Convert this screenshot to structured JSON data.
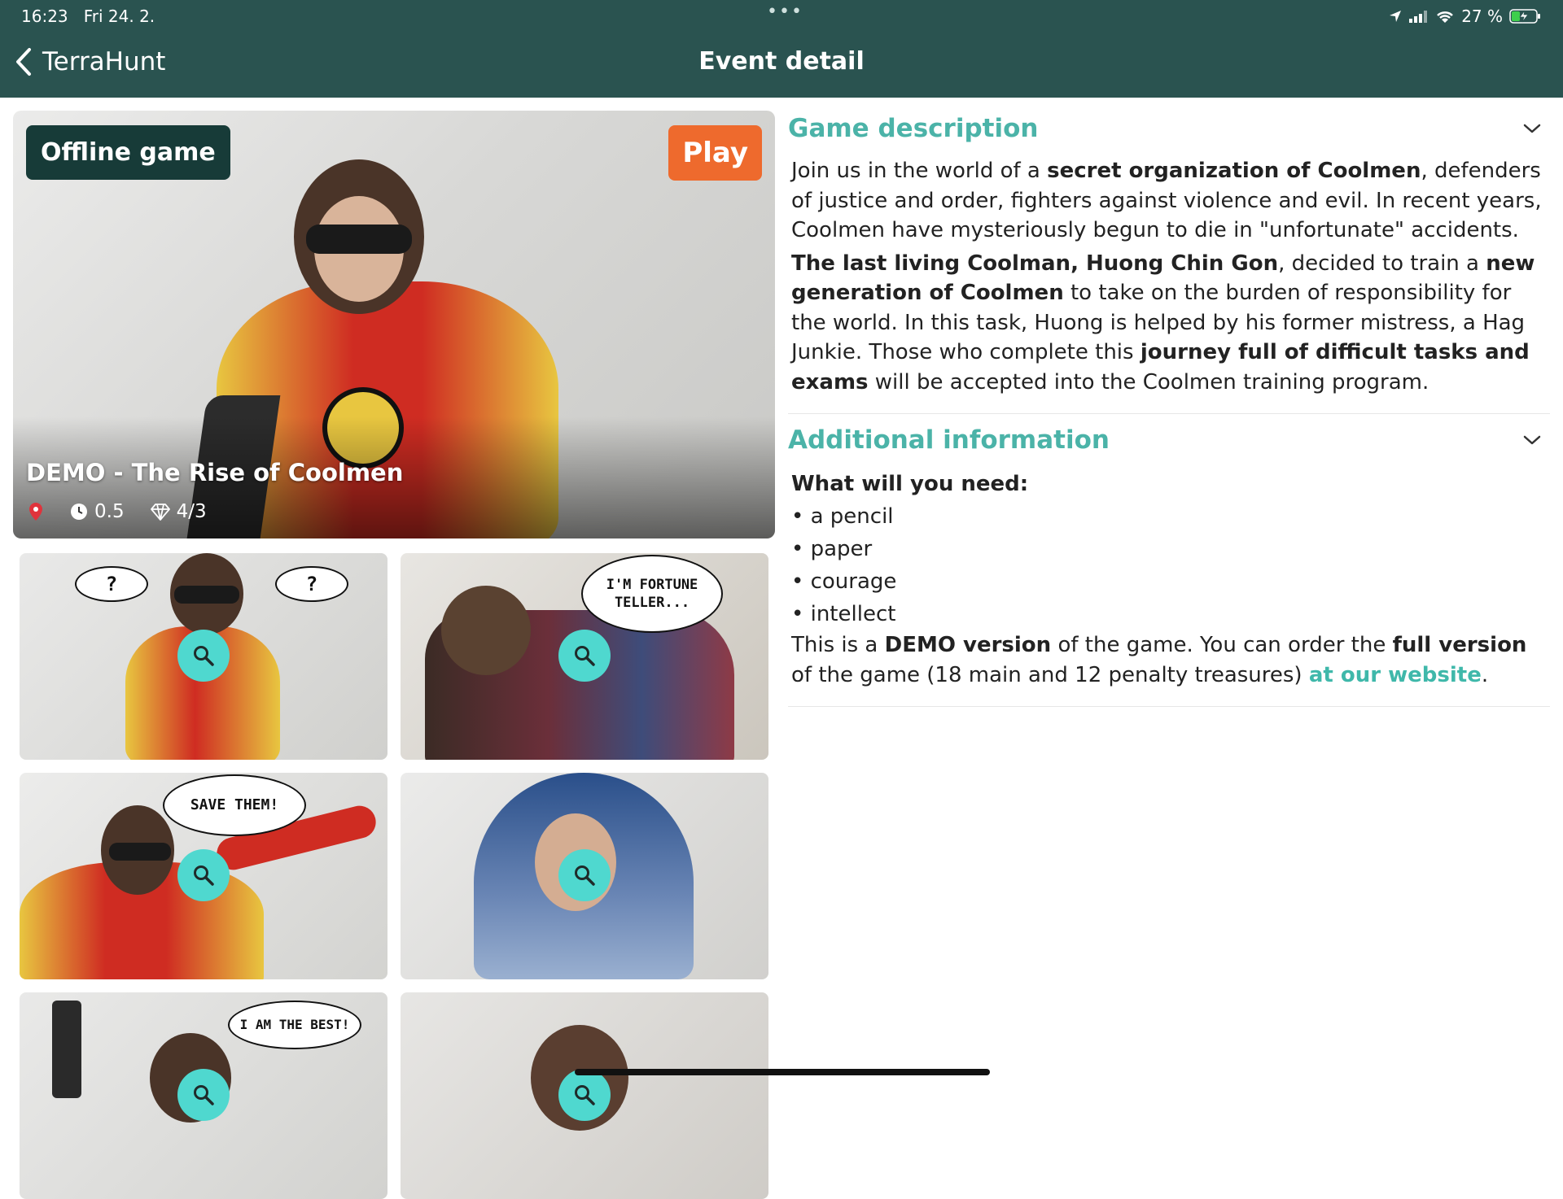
{
  "status_bar": {
    "time": "16:23",
    "date": "Fri 24. 2.",
    "battery": "27 %"
  },
  "nav": {
    "back_label": "TerraHunt",
    "title": "Event detail"
  },
  "hero": {
    "badge": "Offline game",
    "play_label": "Play",
    "title": "DEMO - The Rise of Coolmen",
    "duration": "0.5",
    "treasures": "4/3"
  },
  "thumbnails": [
    {
      "bubble_left": "?",
      "bubble_right": "?"
    },
    {
      "bubble": "I'M FORTUNE TELLER..."
    },
    {
      "bubble": "SAVE THEM!"
    },
    {},
    {
      "bubble": "I AM THE BEST!"
    },
    {}
  ],
  "description": {
    "title": "Game description",
    "p1": {
      "a": "Join us in the world of a ",
      "b": "secret organization of Coolmen",
      "c": ", defenders of justice and order, fighters against violence and evil. In recent years, Coolmen have mysteriously begun to die in \"unfortunate\" accidents."
    },
    "p2": {
      "a": "The last living Coolman, Huong Chin Gon",
      "b": ", decided to train a ",
      "c": "new generation of Coolmen",
      "d": " to take on the burden of responsibility for the world. In this task, Huong is helped by his former mistress, a Hag Junkie. Those who complete this ",
      "e": "journey full of difficult tasks and exams",
      "f": " will be accepted into the Coolmen training program."
    }
  },
  "additional": {
    "title": "Additional information",
    "need_heading": "What will you need:",
    "items": [
      "a pencil",
      "paper",
      "courage",
      "intellect"
    ],
    "demo": {
      "a": "This is a ",
      "b": "DEMO version",
      "c": " of the game. You can order the ",
      "d": "full version",
      "e": " of the game (18 main and 12 penalty treasures) ",
      "link": "at our website",
      "f": "."
    }
  },
  "colors": {
    "header": "#2a5350",
    "accent": "#4bb3a8",
    "play": "#ee6a2d",
    "badge": "#173b38",
    "zoom": "#4fd8cf"
  }
}
